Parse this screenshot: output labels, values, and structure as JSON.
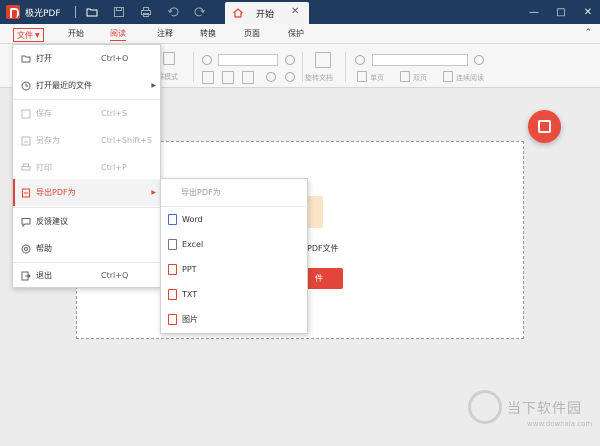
{
  "app": {
    "name": "极光PDF"
  },
  "titlebar": {
    "tab_label": "开始",
    "window_controls": [
      "—",
      "□",
      "✕"
    ]
  },
  "menubar": {
    "file_label": "文件",
    "items": [
      "开始",
      "阅读",
      "注释",
      "转换",
      "页面",
      "保护"
    ],
    "active": "阅读"
  },
  "toolbar": {
    "items": [
      {
        "label": "屏模式"
      },
      {
        "label": "旋转文档"
      },
      {
        "label": "单页"
      },
      {
        "label": "双页"
      },
      {
        "label": "连续阅读"
      }
    ]
  },
  "content": {
    "open_label": "开PDF文件",
    "open_button": "件"
  },
  "file_menu": {
    "items": [
      {
        "label": "打开",
        "shortcut": "Ctrl+O",
        "state": "normal"
      },
      {
        "label": "打开最近的文件",
        "shortcut": "",
        "state": "normal",
        "submenu": true
      },
      {
        "label": "保存",
        "shortcut": "Ctrl+S",
        "state": "disabled"
      },
      {
        "label": "另存为",
        "shortcut": "Ctrl+Shift+S",
        "state": "disabled"
      },
      {
        "label": "打印",
        "shortcut": "Ctrl+P",
        "state": "disabled"
      },
      {
        "label": "导出PDF为",
        "shortcut": "",
        "state": "hover",
        "submenu": true
      },
      {
        "label": "反馈建议",
        "shortcut": "",
        "state": "normal"
      },
      {
        "label": "帮助",
        "shortcut": "",
        "state": "normal"
      },
      {
        "label": "退出",
        "shortcut": "Ctrl+Q",
        "state": "normal"
      }
    ]
  },
  "export_menu": {
    "header": "导出PDF为",
    "items": [
      "Word",
      "Excel",
      "PPT",
      "TXT",
      "图片"
    ]
  },
  "watermark": {
    "text": "当下软件园",
    "url": "www.downxia.com"
  },
  "colors": {
    "titlebar": "#1f3c5e",
    "accent": "#e0433a",
    "button": "#e3453b"
  }
}
